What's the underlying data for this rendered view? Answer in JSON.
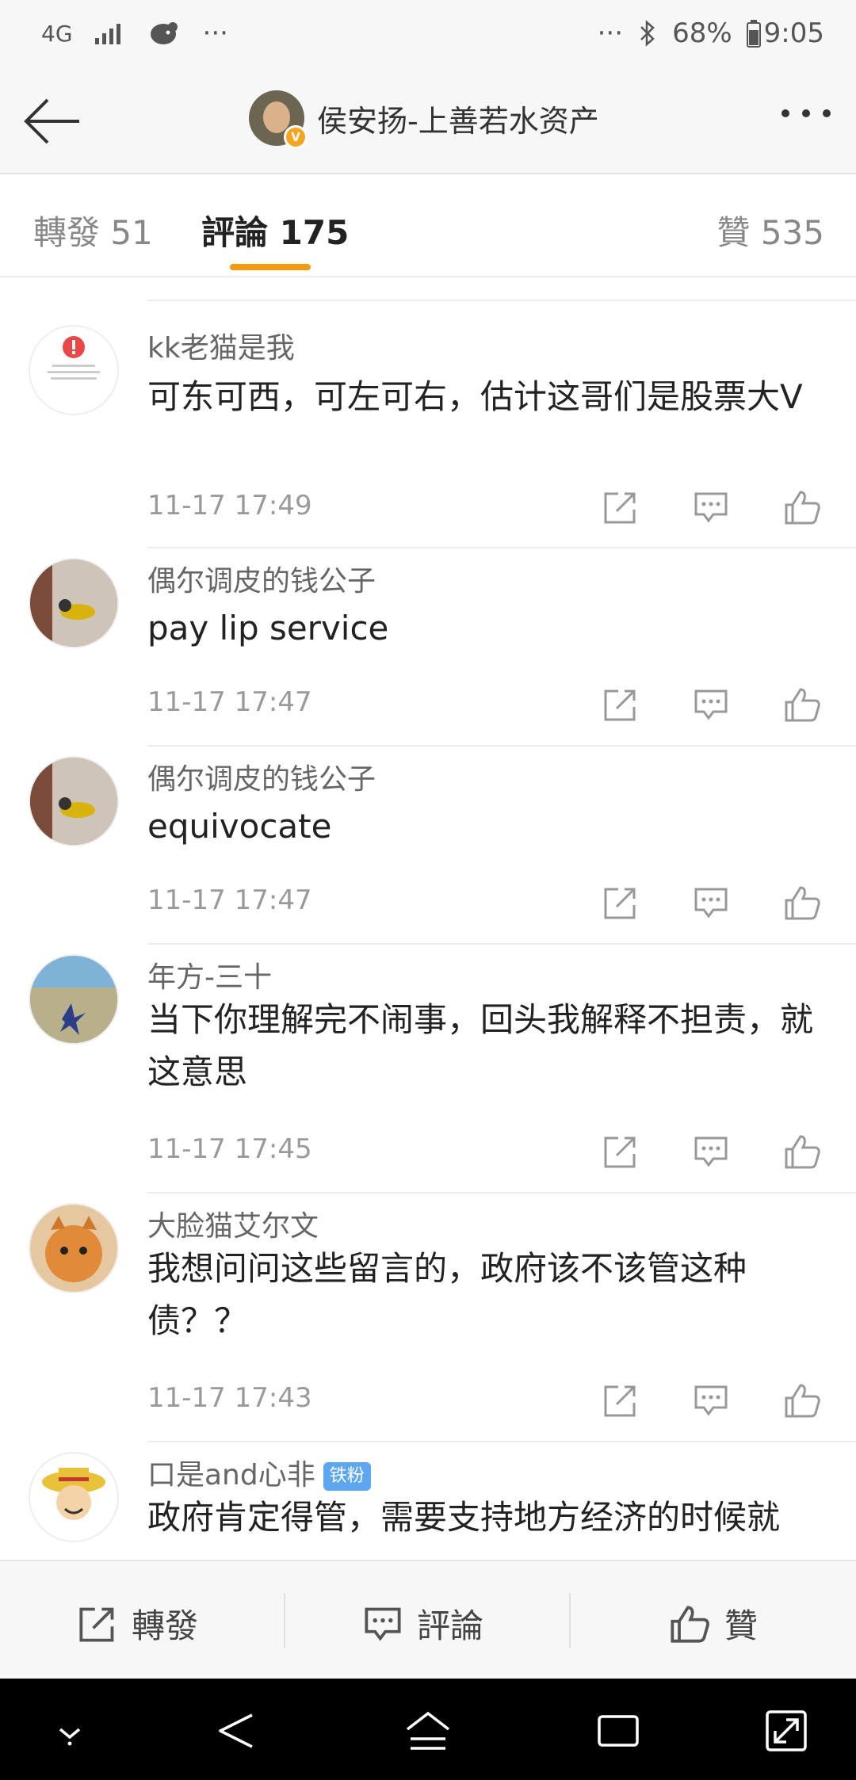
{
  "status_bar": {
    "network": "4G",
    "more": "···",
    "battery": "68%",
    "time": "9:05"
  },
  "header": {
    "title": "侯安扬-上善若水资产",
    "verified": "V"
  },
  "tabs": [
    {
      "label": "轉發 51"
    },
    {
      "label": "評論 175"
    },
    {
      "label": "贊 535"
    }
  ],
  "comments": [
    {
      "name": "kk老猫是我",
      "text": "可东可西，可左可右，估计这哥们是股票大V",
      "time": "11-17 17:49"
    },
    {
      "name": "偶尔调皮的钱公子",
      "text": "pay lip service",
      "time": "11-17 17:47"
    },
    {
      "name": "偶尔调皮的钱公子",
      "text": "equivocate",
      "time": "11-17 17:47"
    },
    {
      "name": "年方-三十",
      "text": "当下你理解完不闹事，回头我解释不担责，就这意思",
      "time": "11-17 17:45"
    },
    {
      "name": "大脸猫艾尔文",
      "text": "我想问问这些留言的，政府该不该管这种债？？",
      "time": "11-17 17:43"
    },
    {
      "name": "口是and心非",
      "badge": "铁粉",
      "text": "政府肯定得管，需要支持地方经济的时候就"
    }
  ],
  "bottom_bar": {
    "repost": "轉發",
    "comment": "評論",
    "like": "贊"
  },
  "colors": {
    "accent": "#f29b11",
    "badge": "#5ea7f0"
  }
}
